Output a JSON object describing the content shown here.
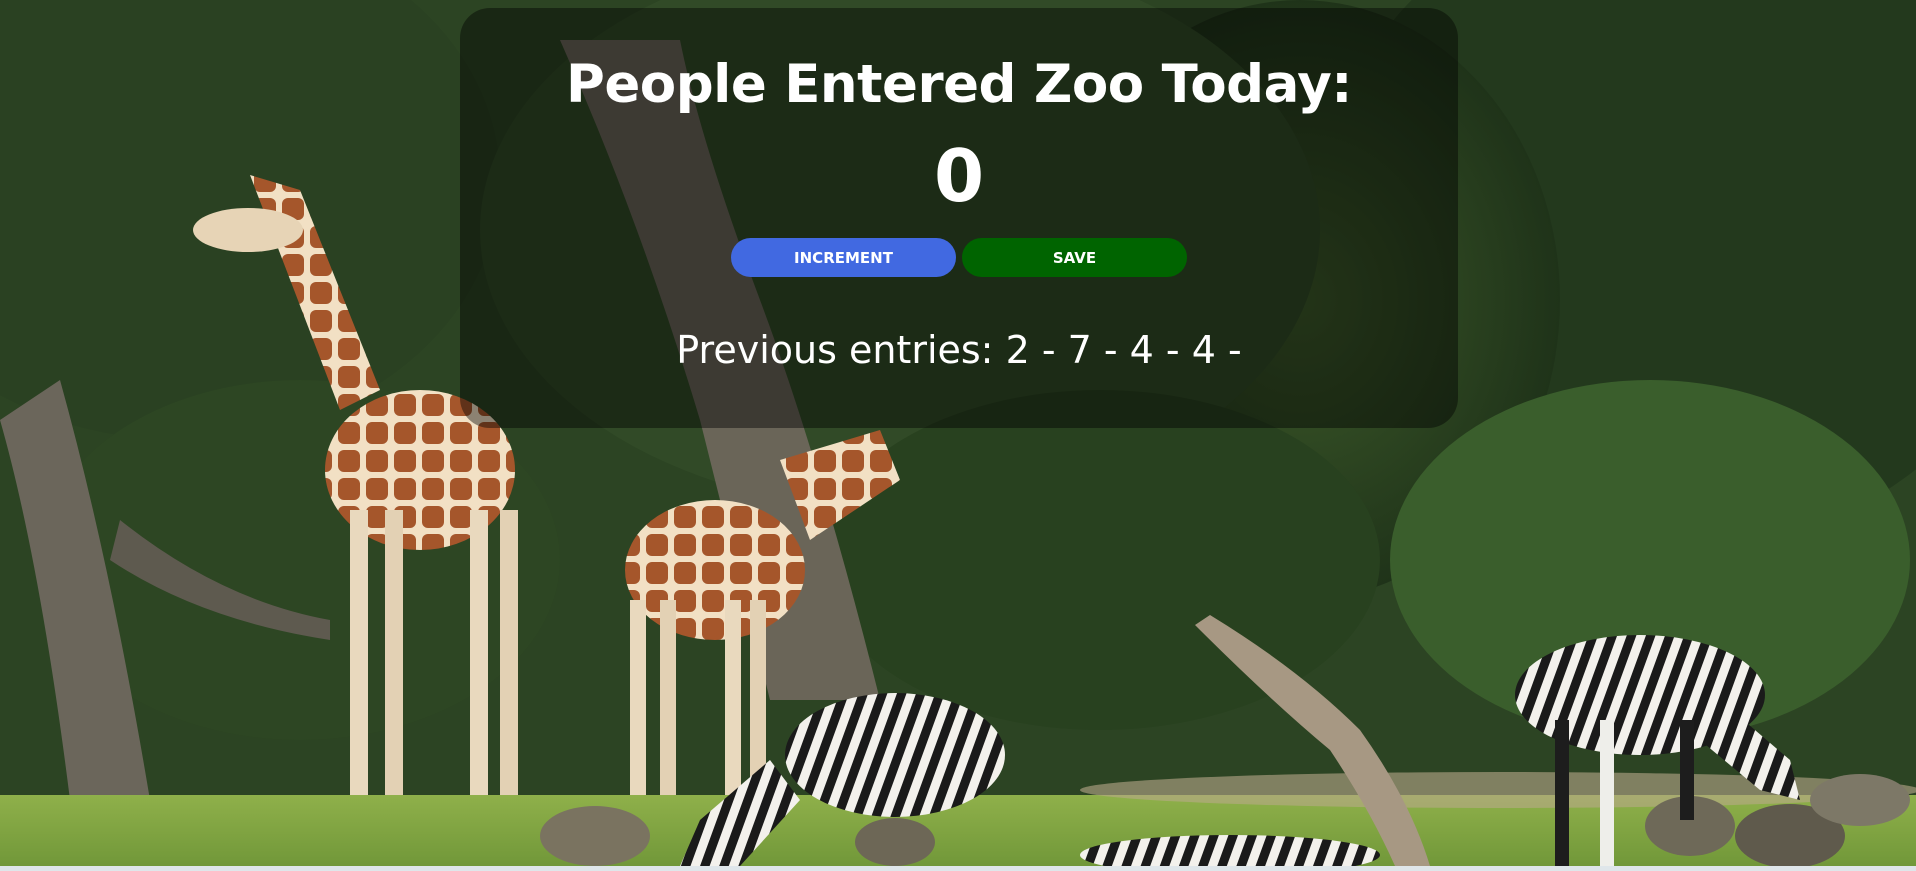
{
  "page": {
    "title": "People Entered Zoo Today:",
    "count": "0",
    "buttons": {
      "increment_label": "INCREMENT",
      "save_label": "SAVE"
    },
    "previous_entries": "Previous entries: 2 - 7 - 4 - 4 -"
  },
  "colors": {
    "increment_button": "#4169e1",
    "save_button": "#006400",
    "panel_overlay": "rgba(0,0,0,0.42)",
    "text": "#ffffff"
  },
  "background": {
    "description_icon": "zoo-photo-background"
  }
}
